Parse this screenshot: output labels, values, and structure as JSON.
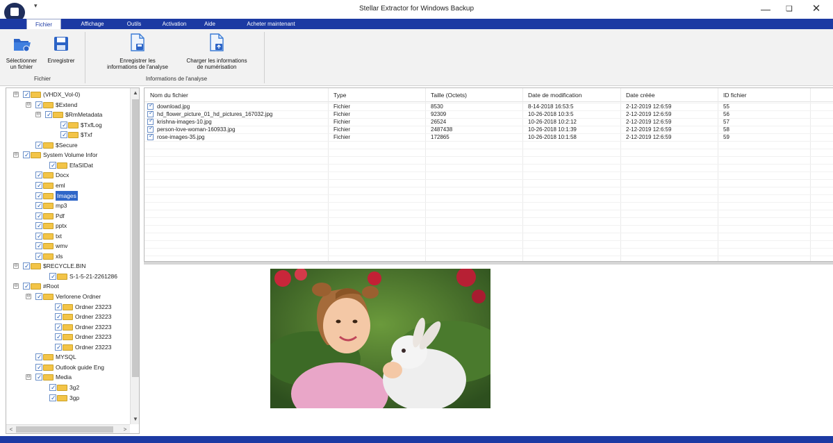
{
  "window": {
    "title": "Stellar Extractor for Windows Backup",
    "controls": {
      "minimize": "—",
      "maximize": "❏",
      "close": "✕"
    }
  },
  "ribbon": {
    "tabs": [
      {
        "label": "Fichier",
        "active": true
      },
      {
        "label": "Affichage",
        "active": false
      },
      {
        "label": "Outils",
        "active": false
      },
      {
        "label": "Activation",
        "active": false
      },
      {
        "label": "Aide",
        "active": false
      },
      {
        "label": "Acheter maintenant",
        "active": false
      }
    ],
    "groups": [
      {
        "label": "Fichier",
        "buttons": [
          {
            "line1": "Sélectionner",
            "line2": "un fichier",
            "icon": "folder-open-icon"
          },
          {
            "line1": "Enregistrer",
            "line2": "",
            "icon": "save-disk-icon"
          }
        ]
      },
      {
        "label": "Informations de l'analyse",
        "buttons": [
          {
            "line1": "Enregistrer les",
            "line2": "informations de l'analyse",
            "icon": "save-scan-document-icon"
          },
          {
            "line1": "Charger les informations",
            "line2": "de numérisation",
            "icon": "load-scan-document-icon"
          }
        ]
      }
    ]
  },
  "tree": {
    "items": [
      {
        "label": "(VHDX_Vol-0)",
        "expander": "⊖"
      },
      {
        "label": "$Extend",
        "expander": "⊖"
      },
      {
        "label": "$RmMetadata",
        "expander": "⊖"
      },
      {
        "label": "$TxfLog",
        "expander": ""
      },
      {
        "label": "$Txf",
        "expander": ""
      },
      {
        "label": "$Secure",
        "expander": ""
      },
      {
        "label": "System Volume Infor",
        "expander": "⊖"
      },
      {
        "label": "EfaSIDat",
        "expander": ""
      },
      {
        "label": "Docx",
        "expander": ""
      },
      {
        "label": "eml",
        "expander": ""
      },
      {
        "label": "Images",
        "expander": "",
        "selected": true
      },
      {
        "label": "mp3",
        "expander": ""
      },
      {
        "label": "Pdf",
        "expander": ""
      },
      {
        "label": "pptx",
        "expander": ""
      },
      {
        "label": "txt",
        "expander": ""
      },
      {
        "label": "wmv",
        "expander": ""
      },
      {
        "label": "xls",
        "expander": ""
      },
      {
        "label": "$RECYCLE.BIN",
        "expander": "⊖"
      },
      {
        "label": "S-1-5-21-2261286",
        "expander": ""
      },
      {
        "label": "#Root",
        "expander": "⊖"
      },
      {
        "label": "Verlorene Ordner",
        "expander": "⊖"
      },
      {
        "label": "Ordner 23223",
        "expander": ""
      },
      {
        "label": "Ordner 23223",
        "expander": ""
      },
      {
        "label": "Ordner 23223",
        "expander": ""
      },
      {
        "label": "Ordner 23223",
        "expander": ""
      },
      {
        "label": "Ordner 23223",
        "expander": ""
      },
      {
        "label": "MYSQL",
        "expander": ""
      },
      {
        "label": "Outlook guide Eng",
        "expander": ""
      },
      {
        "label": "Media",
        "expander": "⊖"
      },
      {
        "label": "3g2",
        "expander": ""
      },
      {
        "label": "3gp",
        "expander": ""
      }
    ],
    "scroll": {
      "up": "▲",
      "down": "▼",
      "left": "<",
      "right": ">"
    }
  },
  "file_list": {
    "columns": [
      "Nom du fichier",
      "Type",
      "Taille (Octets)",
      "Date de modification",
      "Date créée",
      "ID fichier"
    ],
    "rows": [
      {
        "name": "download.jpg",
        "type": "Fichier",
        "size": "8530",
        "modified": "8-14-2018 16:53:5",
        "created": "2-12-2019 12:6:59",
        "id": "55"
      },
      {
        "name": "hd_flower_picture_01_hd_pictures_167032.jpg",
        "type": "Fichier",
        "size": "92309",
        "modified": "10-26-2018 10:3:5",
        "created": "2-12-2019 12:6:59",
        "id": "56"
      },
      {
        "name": "krishna-images-10.jpg",
        "type": "Fichier",
        "size": "26524",
        "modified": "10-26-2018 10:2:12",
        "created": "2-12-2019 12:6:59",
        "id": "57"
      },
      {
        "name": "person-love-woman-160933.jpg",
        "type": "Fichier",
        "size": "2487438",
        "modified": "10-26-2018 10:1:39",
        "created": "2-12-2019 12:6:59",
        "id": "58"
      },
      {
        "name": "rose-images-35.jpg",
        "type": "Fichier",
        "size": "172865",
        "modified": "10-26-2018 10:1:58",
        "created": "2-12-2019 12:6:59",
        "id": "59"
      }
    ]
  },
  "preview": {
    "icon": "image-preview-photo"
  },
  "colors": {
    "accent": "#1c3aa3",
    "selection": "#2f66c8",
    "folder": "#f3c447"
  }
}
